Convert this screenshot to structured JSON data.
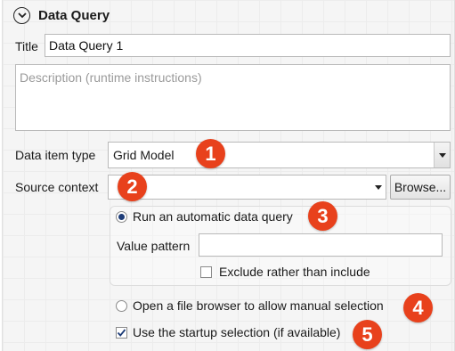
{
  "section": {
    "title": "Data Query"
  },
  "title_field": {
    "label": "Title",
    "value": "Data Query 1"
  },
  "description": {
    "placeholder": "Description (runtime instructions)"
  },
  "data_item_type": {
    "label": "Data item type",
    "value": "Grid Model"
  },
  "source_context": {
    "label": "Source context",
    "value": "",
    "browse_label": "Browse..."
  },
  "auto_query": {
    "radio_label": "Run an automatic data query",
    "selected": true,
    "value_pattern_label": "Value pattern",
    "value_pattern_value": "",
    "exclude_label": "Exclude rather than include",
    "exclude_checked": false
  },
  "file_browser": {
    "radio_label": "Open a file browser to allow manual selection",
    "selected": false
  },
  "startup": {
    "label": "Use the startup selection (if available)",
    "checked": true
  },
  "callouts": [
    "1",
    "2",
    "3",
    "4",
    "5"
  ],
  "colors": {
    "callout": "#e8411c",
    "radio_dot": "#1d3c78"
  }
}
